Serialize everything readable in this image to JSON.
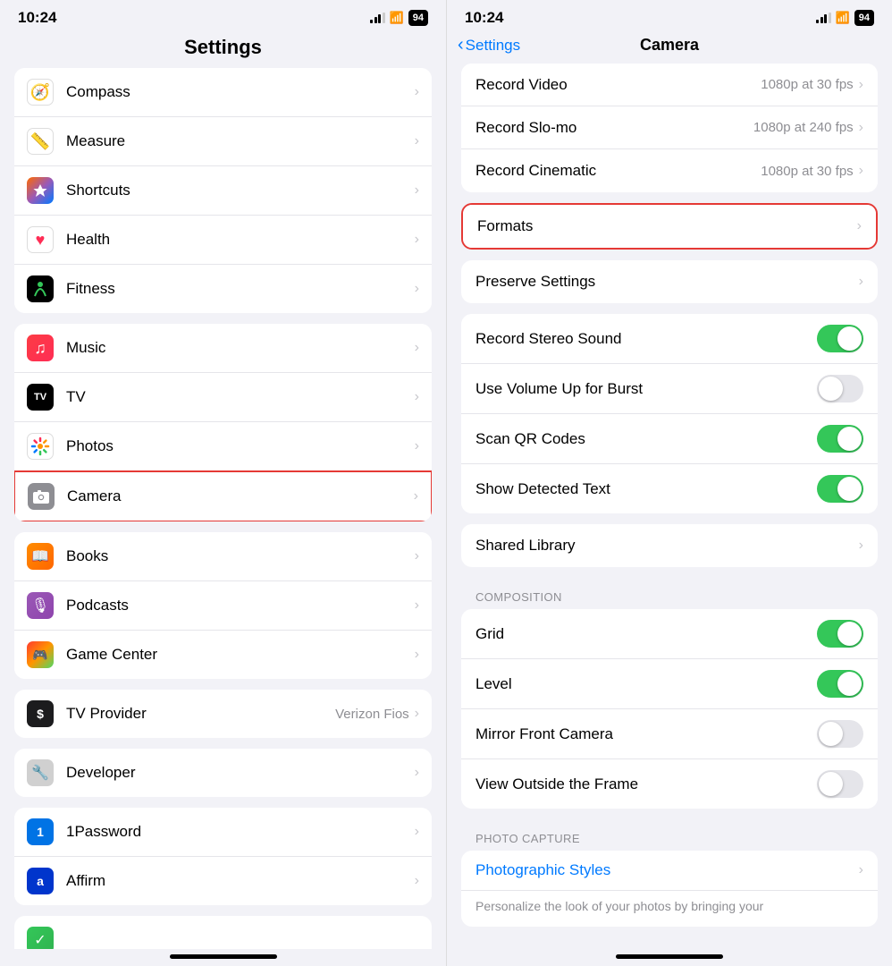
{
  "left": {
    "time": "10:24",
    "battery": "94",
    "title": "Settings",
    "items_top": [
      {
        "id": "compass",
        "label": "Compass",
        "iconClass": "icon-compass",
        "iconText": "🧭"
      },
      {
        "id": "measure",
        "label": "Measure",
        "iconClass": "icon-measure",
        "iconText": "📏"
      },
      {
        "id": "shortcuts",
        "label": "Shortcuts",
        "iconClass": "icon-shortcuts",
        "iconText": "⊹"
      },
      {
        "id": "health",
        "label": "Health",
        "iconClass": "icon-health",
        "iconText": "❤️"
      },
      {
        "id": "fitness",
        "label": "Fitness",
        "iconClass": "icon-fitness",
        "iconText": "🏃"
      }
    ],
    "items_mid": [
      {
        "id": "music",
        "label": "Music",
        "iconClass": "icon-music",
        "iconText": "♫"
      },
      {
        "id": "tv",
        "label": "TV",
        "iconClass": "icon-tv",
        "iconText": "📺"
      },
      {
        "id": "photos",
        "label": "Photos",
        "iconClass": "icon-photos",
        "iconText": "🌸"
      },
      {
        "id": "camera",
        "label": "Camera",
        "iconClass": "icon-camera",
        "iconText": "📷",
        "highlighted": true
      }
    ],
    "items_mid2": [
      {
        "id": "books",
        "label": "Books",
        "iconClass": "icon-books",
        "iconText": "📖"
      },
      {
        "id": "podcasts",
        "label": "Podcasts",
        "iconClass": "icon-podcasts",
        "iconText": "🎙"
      },
      {
        "id": "gamecenter",
        "label": "Game Center",
        "iconClass": "icon-gamecenter",
        "iconText": "🎮"
      }
    ],
    "items_tvprovider": [
      {
        "id": "tvprovider",
        "label": "TV Provider",
        "value": "Verizon Fios",
        "iconClass": "icon-tvprovider",
        "iconText": "$"
      }
    ],
    "items_developer": [
      {
        "id": "developer",
        "label": "Developer",
        "iconClass": "icon-developer",
        "iconText": "🔧"
      }
    ],
    "items_bottom": [
      {
        "id": "1password",
        "label": "1Password",
        "iconClass": "icon-1password",
        "iconText": "1"
      },
      {
        "id": "affirm",
        "label": "Affirm",
        "iconClass": "icon-affirm",
        "iconText": "a"
      }
    ]
  },
  "right": {
    "time": "10:24",
    "battery": "94",
    "back_label": "Settings",
    "title": "Camera",
    "rows_video": [
      {
        "id": "record-video",
        "label": "Record Video",
        "value": "1080p at 30 fps"
      },
      {
        "id": "record-slomo",
        "label": "Record Slo-mo",
        "value": "1080p at 240 fps"
      },
      {
        "id": "record-cinematic",
        "label": "Record Cinematic",
        "value": "1080p at 30 fps"
      }
    ],
    "formats": {
      "id": "formats",
      "label": "Formats",
      "highlighted": true
    },
    "preserve_settings": {
      "id": "preserve-settings",
      "label": "Preserve Settings"
    },
    "toggles": [
      {
        "id": "record-stereo",
        "label": "Record Stereo Sound",
        "on": true
      },
      {
        "id": "volume-burst",
        "label": "Use Volume Up for Burst",
        "on": false
      },
      {
        "id": "scan-qr",
        "label": "Scan QR Codes",
        "on": true
      },
      {
        "id": "show-text",
        "label": "Show Detected Text",
        "on": true
      }
    ],
    "shared_library": {
      "label": "Shared Library"
    },
    "composition_label": "COMPOSITION",
    "composition_toggles": [
      {
        "id": "grid",
        "label": "Grid",
        "on": true
      },
      {
        "id": "level",
        "label": "Level",
        "on": true
      },
      {
        "id": "mirror-front",
        "label": "Mirror Front Camera",
        "on": false
      },
      {
        "id": "view-outside",
        "label": "View Outside the Frame",
        "on": false
      }
    ],
    "photo_capture_label": "PHOTO CAPTURE",
    "photo_styles_label": "Photographic Styles",
    "photo_styles_desc": "Personalize the look of your photos by bringing your"
  }
}
